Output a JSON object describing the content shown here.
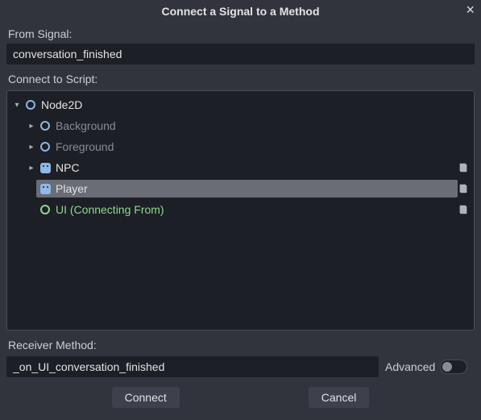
{
  "dialog": {
    "title": "Connect a Signal to a Method",
    "close_glyph": "×"
  },
  "labels": {
    "from_signal": "From Signal:",
    "connect_to_script": "Connect to Script:",
    "receiver_method": "Receiver Method:",
    "advanced": "Advanced"
  },
  "fields": {
    "signal_name": "conversation_finished",
    "receiver_method": "_on_UI_conversation_finished"
  },
  "tree": {
    "nodes": [
      {
        "name": "Node2D",
        "icon": "node2d",
        "color": "#8fb7e8",
        "depth": 0,
        "expand": "down",
        "muted": false,
        "script": false,
        "selected": false,
        "source": false
      },
      {
        "name": "Background",
        "icon": "node2d",
        "color": "#8fb7e8",
        "depth": 1,
        "expand": "right",
        "muted": true,
        "script": false,
        "selected": false,
        "source": false
      },
      {
        "name": "Foreground",
        "icon": "node2d",
        "color": "#8fb7e8",
        "depth": 1,
        "expand": "right",
        "muted": true,
        "script": false,
        "selected": false,
        "source": false
      },
      {
        "name": "NPC",
        "icon": "sprite",
        "color": "#8fb7e8",
        "depth": 1,
        "expand": "right",
        "muted": false,
        "script": true,
        "selected": false,
        "source": false
      },
      {
        "name": "Player",
        "icon": "sprite",
        "color": "#8fb7e8",
        "depth": 1,
        "expand": "none",
        "muted": false,
        "script": true,
        "selected": true,
        "source": false
      },
      {
        "name": "UI (Connecting From)",
        "icon": "control",
        "color": "#8dd88f",
        "depth": 1,
        "expand": "none",
        "muted": false,
        "script": true,
        "selected": false,
        "source": true
      }
    ]
  },
  "buttons": {
    "connect": "Connect",
    "cancel": "Cancel"
  },
  "advanced": {
    "enabled": false
  }
}
